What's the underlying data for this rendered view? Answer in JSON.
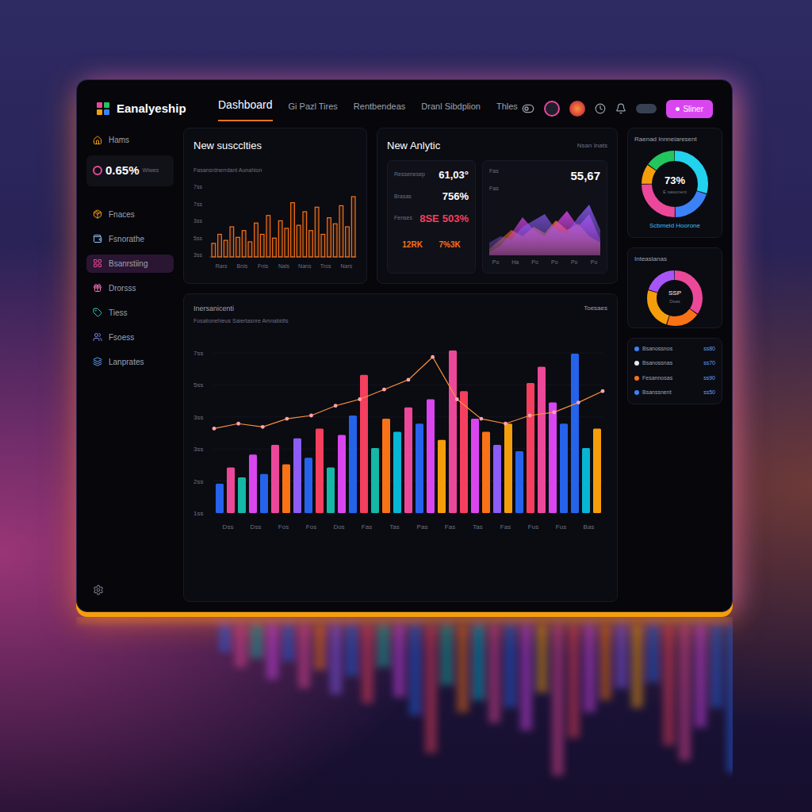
{
  "logo": {
    "text": "Eanalyeship"
  },
  "nav": [
    {
      "label": "Dashboard",
      "selected": true
    },
    {
      "label": "Gi Pazl Tires",
      "selected": false
    },
    {
      "label": "Rentbendeas",
      "selected": false
    },
    {
      "label": "Dranl Sibdplion",
      "selected": false
    },
    {
      "label": "Thles",
      "selected": false
    }
  ],
  "header_button": {
    "label": "Sliner"
  },
  "sidebar": {
    "home": "Hams",
    "stat": {
      "value": "0.65%",
      "label": "Wiwes"
    },
    "items": [
      {
        "label": "Fnaces",
        "selected": false,
        "color": "#f59e0b"
      },
      {
        "label": "Fsnorathe",
        "selected": false,
        "color": "#93c5fd"
      },
      {
        "label": "Bsanrstiing",
        "selected": true,
        "color": "#ec4899"
      },
      {
        "label": "Drorsss",
        "selected": false,
        "color": "#f472b6"
      },
      {
        "label": "Tiess",
        "selected": false,
        "color": "#2dd4bf"
      },
      {
        "label": "Fsoess",
        "selected": false,
        "color": "#818cf8"
      },
      {
        "label": "Lanprates",
        "selected": false,
        "color": "#60a5fa"
      }
    ]
  },
  "subscriptions": {
    "title": "New suscclties",
    "subtitle": "Fasansrdnerrdant Aunahion",
    "y_ticks": [
      "7ss",
      "7ss",
      "3ss",
      "5ss",
      "3ss"
    ],
    "x_ticks": [
      "Rars",
      "Bnis",
      "Fnis",
      "Nals",
      "Nans",
      "Tros",
      "Nars"
    ],
    "values": [
      18,
      30,
      22,
      40,
      26,
      35,
      20,
      45,
      30,
      55,
      25,
      48,
      38,
      72,
      42,
      60,
      35,
      66,
      30,
      52,
      44,
      68,
      40,
      80
    ]
  },
  "analytics": {
    "title": "New Anlytic",
    "link": "Nsan Inats",
    "stats": [
      {
        "label": "Ressenesep",
        "values": [
          "61,03°"
        ],
        "color": "#ffffff"
      },
      {
        "label": "Brasas",
        "values": [
          "756%"
        ],
        "color": "#ffffff"
      },
      {
        "label": "Fenses",
        "values": [
          "8SE",
          "503%"
        ],
        "color": "#f43f5e"
      }
    ],
    "footer": [
      "12RK",
      "7%3K"
    ]
  },
  "area": {
    "value": "55,67",
    "y_ticks": [
      "Fas",
      "Fas"
    ],
    "x_ticks": [
      "Po",
      "Ha",
      "Po",
      "Po",
      "Po",
      "Po"
    ],
    "series": [
      {
        "color": "#f97316",
        "values": [
          10,
          25,
          40,
          30,
          45,
          35,
          55,
          40,
          50,
          30,
          20
        ]
      },
      {
        "color": "#d946ef",
        "values": [
          5,
          15,
          35,
          60,
          40,
          30,
          50,
          70,
          45,
          65,
          25
        ]
      },
      {
        "color": "#8b5cf6",
        "values": [
          20,
          30,
          25,
          45,
          55,
          65,
          40,
          35,
          60,
          80,
          40
        ]
      }
    ]
  },
  "main_chart": {
    "title": "Inersanicenti",
    "subtitle": "Fosalionehieus Saiertasnre Amnabidts",
    "legend": "Toesaes",
    "y_ticks": [
      "7ss",
      "5ss",
      "3ss",
      "3ss",
      "2ss",
      "1ss"
    ],
    "x_ticks": [
      "Dss",
      "Dss",
      "Fos",
      "Fos",
      "Dos",
      "Fas",
      "Tas",
      "Pas",
      "Fas",
      "Tas",
      "Fas",
      "Fus",
      "Fus",
      "Bas"
    ],
    "bars": [
      {
        "value": 18,
        "color": "#2563eb"
      },
      {
        "value": 28,
        "color": "#ec4899"
      },
      {
        "value": 22,
        "color": "#14b8a6"
      },
      {
        "value": 36,
        "color": "#d946ef"
      },
      {
        "value": 24,
        "color": "#2563eb"
      },
      {
        "value": 42,
        "color": "#ec4899"
      },
      {
        "value": 30,
        "color": "#f97316"
      },
      {
        "value": 46,
        "color": "#8b5cf6"
      },
      {
        "value": 34,
        "color": "#2563eb"
      },
      {
        "value": 52,
        "color": "#f43f5e"
      },
      {
        "value": 28,
        "color": "#14b8a6"
      },
      {
        "value": 48,
        "color": "#d946ef"
      },
      {
        "value": 60,
        "color": "#2563eb"
      },
      {
        "value": 85,
        "color": "#f43f5e"
      },
      {
        "value": 40,
        "color": "#14b8a6"
      },
      {
        "value": 58,
        "color": "#f97316"
      },
      {
        "value": 50,
        "color": "#06b6d4"
      },
      {
        "value": 65,
        "color": "#ec4899"
      },
      {
        "value": 55,
        "color": "#2563eb"
      },
      {
        "value": 70,
        "color": "#d946ef"
      },
      {
        "value": 45,
        "color": "#f59e0b"
      },
      {
        "value": 100,
        "color": "#ec4899"
      },
      {
        "value": 75,
        "color": "#f43f5e"
      },
      {
        "value": 58,
        "color": "#d946ef"
      },
      {
        "value": 50,
        "color": "#f97316"
      },
      {
        "value": 42,
        "color": "#8b5cf6"
      },
      {
        "value": 55,
        "color": "#f59e0b"
      },
      {
        "value": 38,
        "color": "#2563eb"
      },
      {
        "value": 80,
        "color": "#f43f5e"
      },
      {
        "value": 90,
        "color": "#ec4899"
      },
      {
        "value": 68,
        "color": "#d946ef"
      },
      {
        "value": 55,
        "color": "#2563eb"
      },
      {
        "value": 98,
        "color": "#2563eb"
      },
      {
        "value": 40,
        "color": "#06b6d4"
      },
      {
        "value": 52,
        "color": "#f59e0b"
      }
    ],
    "line": [
      52,
      55,
      53,
      58,
      60,
      66,
      70,
      76,
      82,
      96,
      70,
      58,
      55,
      60,
      62,
      68,
      75
    ]
  },
  "donut_main": {
    "title": "Raenad Innneiaresent",
    "value": "73%",
    "caption": "E sasonent",
    "footer": "Scbmeid Hoorone",
    "segments": [
      {
        "share": 0.3,
        "color": "#22d3ee"
      },
      {
        "share": 0.2,
        "color": "#3b82f6"
      },
      {
        "share": 0.25,
        "color": "#ec4899"
      },
      {
        "share": 0.1,
        "color": "#f59e0b"
      },
      {
        "share": 0.15,
        "color": "#22c55e"
      }
    ]
  },
  "donut_small": {
    "title": "Inteaslanas",
    "value": "SSP",
    "caption": "Dsas",
    "segments": [
      {
        "share": 0.35,
        "color": "#ec4899"
      },
      {
        "share": 0.2,
        "color": "#f97316"
      },
      {
        "share": 0.25,
        "color": "#f59e0b"
      },
      {
        "share": 0.2,
        "color": "#a855f7"
      }
    ]
  },
  "legend": [
    {
      "label": "Bsanossnos",
      "value": "ss80",
      "color": "#3b82f6"
    },
    {
      "label": "Bsanossnas",
      "value": "ss70",
      "color": "#e5e7eb"
    },
    {
      "label": "Fesannosas",
      "value": "ss90",
      "color": "#f97316"
    },
    {
      "label": "Bsanssnent",
      "value": "ss50",
      "color": "#3b82f6"
    }
  ]
}
